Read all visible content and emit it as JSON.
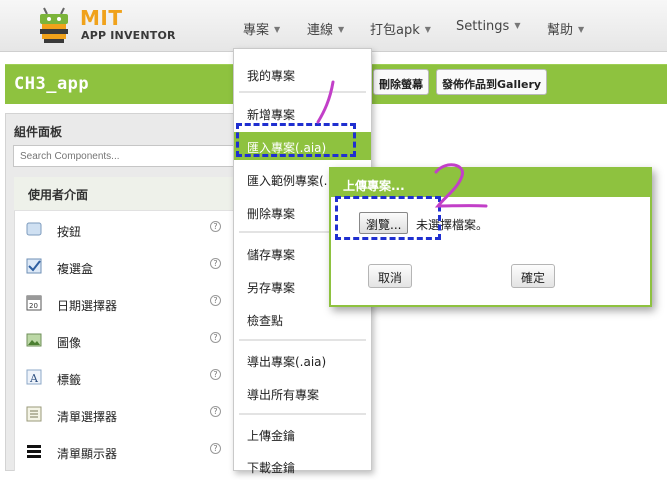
{
  "header": {
    "logo_title": "MIT",
    "logo_subtitle": "APP INVENTOR",
    "nav": [
      "專案",
      "連線",
      "打包apk",
      "Settings",
      "幫助"
    ]
  },
  "project": {
    "name": "CH3_app",
    "buttons": [
      "刪除螢幕",
      "發佈作品到Gallery"
    ]
  },
  "palette": {
    "title": "組件面板",
    "search_placeholder": "Search Components...",
    "category": "使用者介面",
    "items": [
      {
        "label": "按鈕",
        "icon": "button-icon"
      },
      {
        "label": "複選盒",
        "icon": "checkbox-icon"
      },
      {
        "label": "日期選擇器",
        "icon": "calendar-icon"
      },
      {
        "label": "圖像",
        "icon": "image-icon"
      },
      {
        "label": "標籤",
        "icon": "label-icon"
      },
      {
        "label": "清單選擇器",
        "icon": "list-picker-icon"
      },
      {
        "label": "清單顯示器",
        "icon": "list-view-icon"
      }
    ],
    "help_glyph": "?"
  },
  "menu": {
    "items": [
      "我的專案",
      "新增專案",
      "匯入專案(.aia)",
      "匯入範例專案(.",
      "刪除專案",
      "儲存專案",
      "另存專案",
      "檢查點",
      "導出專案(.aia)",
      "導出所有專案",
      "上傳金鑰",
      "下載金鑰"
    ],
    "active_index": 2
  },
  "dialog": {
    "title": "上傳專案...",
    "browse_label": "瀏覽...",
    "file_status": "未選擇檔案。",
    "cancel_label": "取消",
    "ok_label": "確定"
  },
  "colors": {
    "accent_green": "#8ec23f",
    "annotation_blue": "#1f2fd0",
    "annotation_purple": "#c23fc8"
  }
}
